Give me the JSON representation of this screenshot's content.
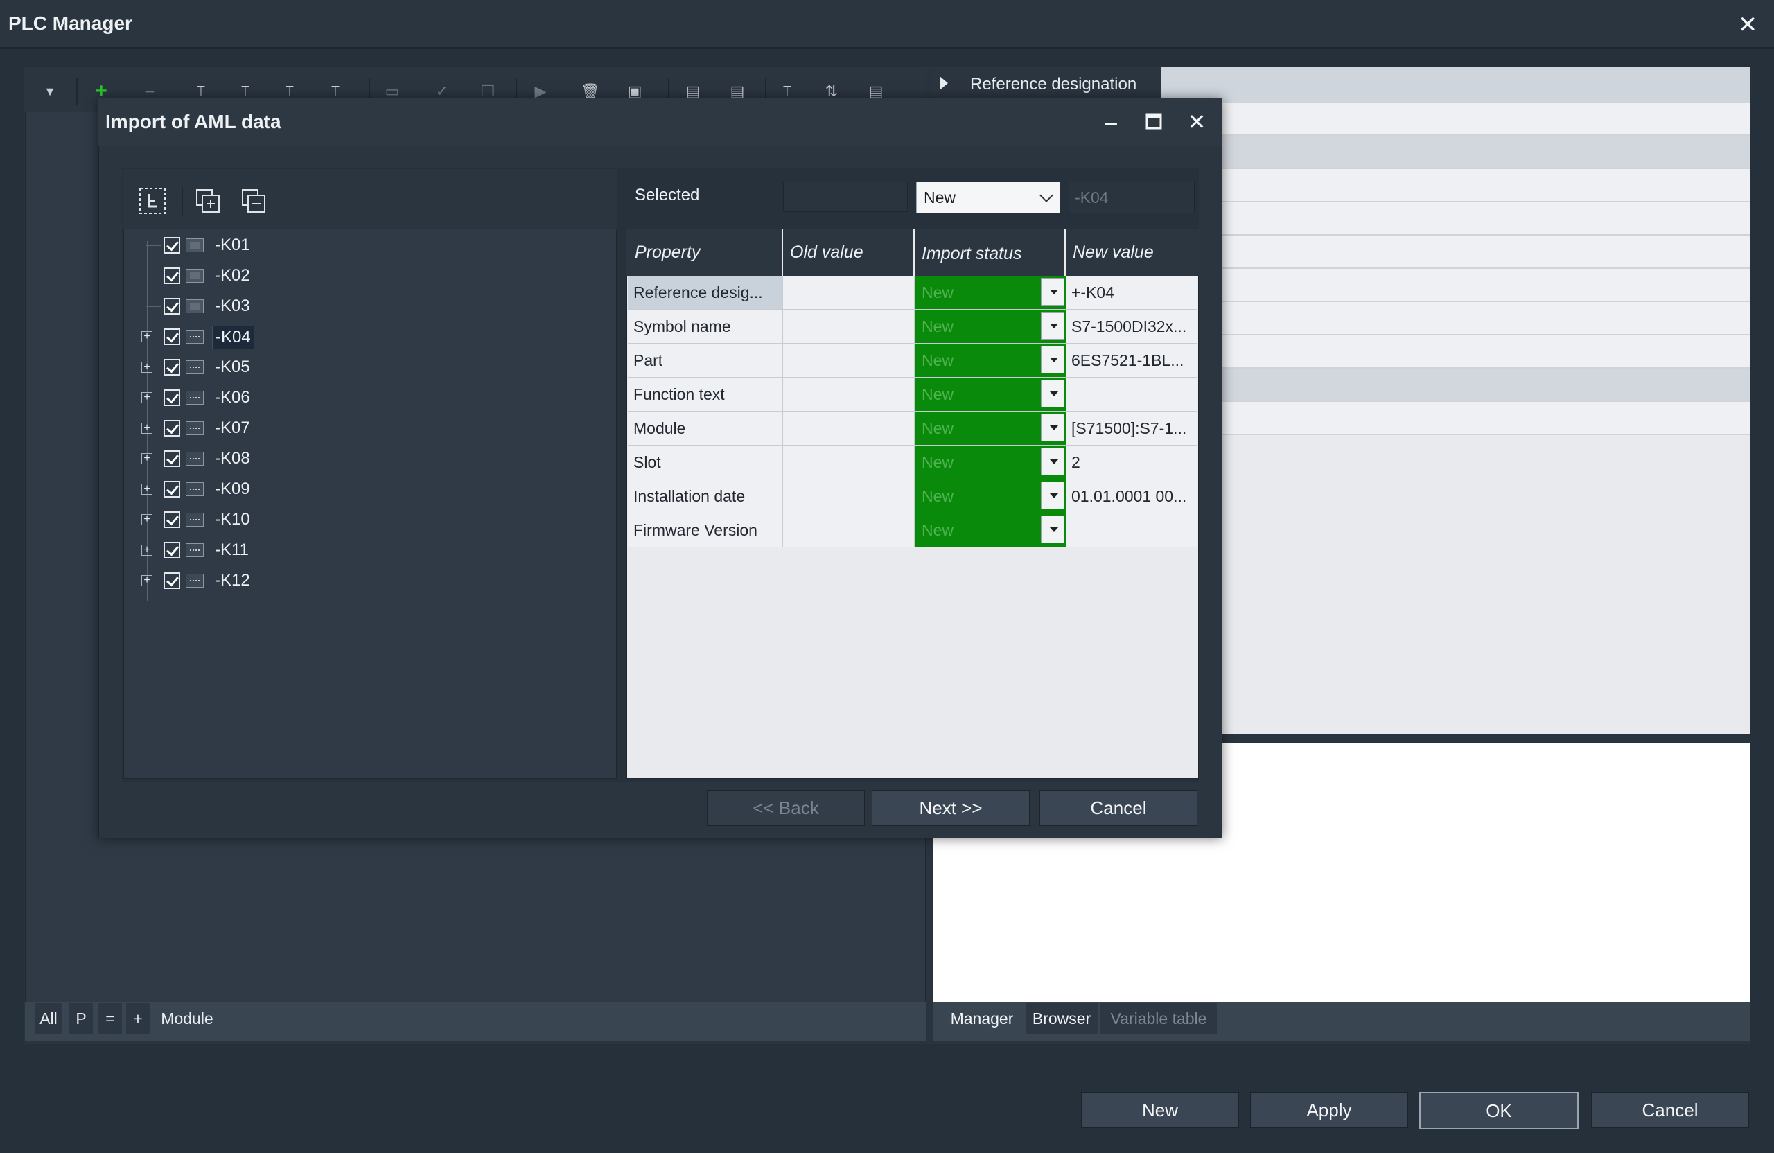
{
  "app": {
    "title": "PLC Manager"
  },
  "right_pane": {
    "header_label": "Reference designation",
    "tabs": [
      {
        "label": "Manager",
        "active": true
      },
      {
        "label": "Browser",
        "active": false
      },
      {
        "label": "Variable table",
        "active": false,
        "disabled": true
      }
    ]
  },
  "left_pane": {
    "tabs": [
      "All",
      "P",
      "=",
      "+",
      "Module"
    ]
  },
  "bottom_buttons": {
    "new": "New",
    "apply": "Apply",
    "ok": "OK",
    "cancel": "Cancel"
  },
  "dialog": {
    "title": "Import of AML data",
    "selected_label": "Selected",
    "selected_status": "New",
    "selected_value": "-K04",
    "tree_items": [
      {
        "label": "-K01",
        "checked": true,
        "expandable": false
      },
      {
        "label": "-K02",
        "checked": true,
        "expandable": false
      },
      {
        "label": "-K03",
        "checked": true,
        "expandable": false
      },
      {
        "label": "-K04",
        "checked": true,
        "expandable": true,
        "selected": true
      },
      {
        "label": "-K05",
        "checked": true,
        "expandable": true
      },
      {
        "label": "-K06",
        "checked": true,
        "expandable": true
      },
      {
        "label": "-K07",
        "checked": true,
        "expandable": true
      },
      {
        "label": "-K08",
        "checked": true,
        "expandable": true
      },
      {
        "label": "-K09",
        "checked": true,
        "expandable": true
      },
      {
        "label": "-K10",
        "checked": true,
        "expandable": true
      },
      {
        "label": "-K11",
        "checked": true,
        "expandable": true
      },
      {
        "label": "-K12",
        "checked": true,
        "expandable": true
      }
    ],
    "grid": {
      "headers": {
        "property": "Property",
        "old_value": "Old value",
        "import_status": "Import status",
        "new_value": "New value"
      },
      "rows": [
        {
          "property": "Reference desig...",
          "old_value": "",
          "status": "New",
          "new_value": "+-K04"
        },
        {
          "property": "Symbol name",
          "old_value": "",
          "status": "New",
          "new_value": "S7-1500DI32x..."
        },
        {
          "property": "Part",
          "old_value": "",
          "status": "New",
          "new_value": "6ES7521-1BL..."
        },
        {
          "property": "Function text",
          "old_value": "",
          "status": "New",
          "new_value": ""
        },
        {
          "property": "Module",
          "old_value": "",
          "status": "New",
          "new_value": "[S71500]:S7-1..."
        },
        {
          "property": "Slot",
          "old_value": "",
          "status": "New",
          "new_value": "2"
        },
        {
          "property": "Installation date",
          "old_value": "",
          "status": "New",
          "new_value": "01.01.0001 00..."
        },
        {
          "property": "Firmware Version",
          "old_value": "",
          "status": "New",
          "new_value": ""
        }
      ]
    },
    "buttons": {
      "back": "<< Back",
      "next": "Next >>",
      "cancel": "Cancel"
    }
  },
  "colors": {
    "status_green": "#0a8a0a",
    "window_bg": "#26303b"
  }
}
